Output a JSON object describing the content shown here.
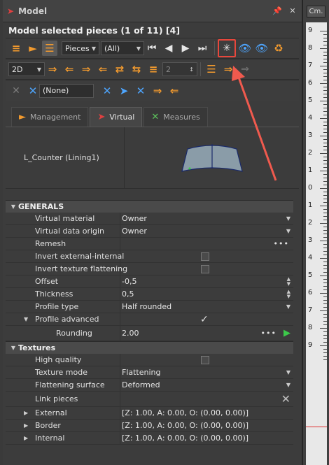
{
  "window": {
    "title": "Model",
    "heading": "Model selected pieces (1 of 11) [4]"
  },
  "toolbar1": {
    "pieces_select": "Pieces",
    "all_select": "(All)"
  },
  "toolbar2": {
    "view_select": "2D",
    "stepper_value": "2"
  },
  "toolbar3": {
    "none_select": "(None)"
  },
  "tabs": [
    {
      "label": "Management"
    },
    {
      "label": "Virtual"
    },
    {
      "label": "Measures"
    }
  ],
  "piece": {
    "label": "L_Counter (Lining1)"
  },
  "generals": {
    "title": "GENERALS",
    "rows": [
      {
        "key": "Virtual material",
        "value": "Owner"
      },
      {
        "key": "Virtual data origin",
        "value": "Owner"
      },
      {
        "key": "Remesh",
        "value": ""
      },
      {
        "key": "Invert external-internal",
        "value": ""
      },
      {
        "key": "Invert texture flattening",
        "value": ""
      },
      {
        "key": "Offset",
        "value": "-0,5"
      },
      {
        "key": "Thickness",
        "value": "0,5"
      },
      {
        "key": "Profile type",
        "value": "Half rounded"
      },
      {
        "key": "Profile advanced",
        "value": ""
      },
      {
        "key": "Rounding",
        "value": "2.00"
      }
    ]
  },
  "textures": {
    "title": "Textures",
    "rows": [
      {
        "key": "High quality",
        "value": ""
      },
      {
        "key": "Texture mode",
        "value": "Flattening"
      },
      {
        "key": "Flattening surface",
        "value": "Deformed"
      },
      {
        "key": "Link pieces",
        "value": ""
      },
      {
        "key": "External",
        "value": "[Z: 1.00, A: 0.00, O: (0.00, 0.00)]"
      },
      {
        "key": "Border",
        "value": "[Z: 1.00, A: 0.00, O: (0.00, 0.00)]"
      },
      {
        "key": "Internal",
        "value": "[Z: 1.00, A: 0.00, O: (0.00, 0.00)]"
      }
    ]
  },
  "ruler": {
    "unit_button": "Cm.",
    "labels": [
      "9",
      "8",
      "7",
      "6",
      "5",
      "4",
      "3",
      "2",
      "1",
      "0",
      "1",
      "2",
      "3",
      "4",
      "5",
      "6",
      "7",
      "8",
      "9"
    ]
  },
  "colors": {
    "accent": "#f29a2e",
    "highlight": "#e8473c",
    "arrow": "#f05a4e",
    "play": "#3cc94a"
  }
}
